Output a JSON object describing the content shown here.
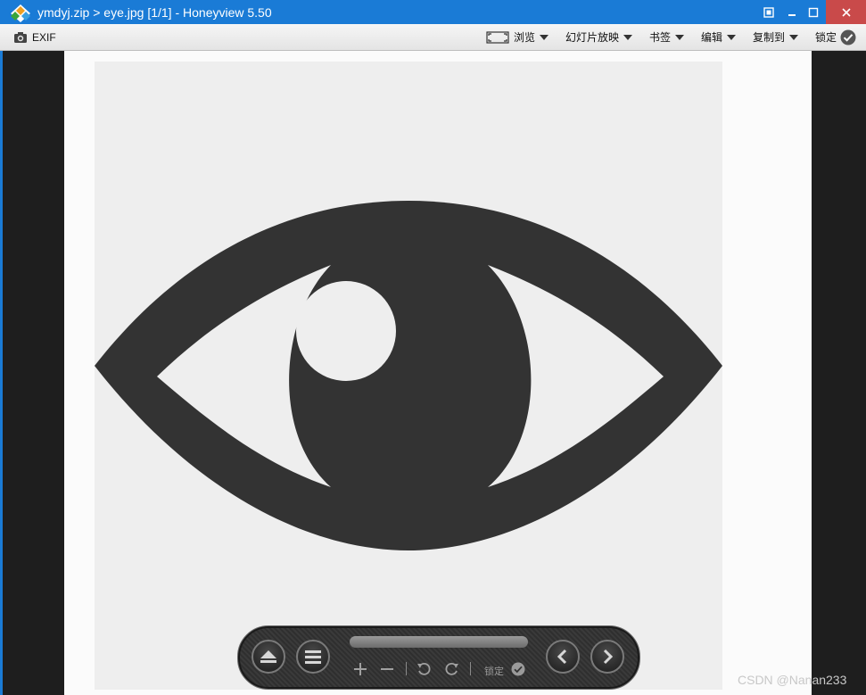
{
  "window": {
    "title": "ymdyj.zip > eye.jpg [1/1] - Honeyview 5.50"
  },
  "toolbar": {
    "exif_label": "EXIF",
    "browse_label": "浏览",
    "slideshow_label": "幻灯片放映",
    "bookmark_label": "书签",
    "edit_label": "编辑",
    "copy_to_label": "复制到",
    "lock_label": "锁定"
  },
  "controls": {
    "lock_label": "锁定"
  },
  "watermark": "CSDN @Nanan233",
  "colors": {
    "title_bar": "#1a7bd6",
    "close_button": "#c94a4a",
    "eye_fill": "#333333",
    "photo_bg": "#eeeeee"
  },
  "icons": {
    "app": "honeyview-diamond-icon",
    "exif": "camera-icon",
    "browse": "frame-icon",
    "lock": "check-circle-icon"
  }
}
